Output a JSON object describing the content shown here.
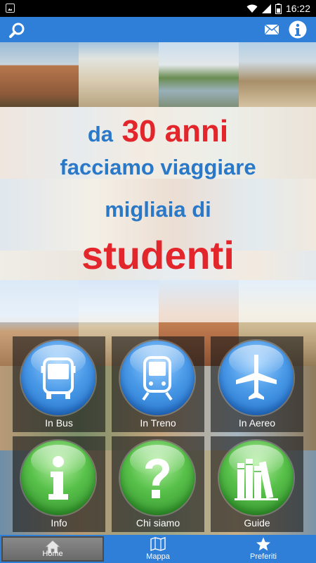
{
  "status_bar": {
    "time": "16:22"
  },
  "app_bar": {
    "search_icon": "search-icon",
    "mail_icon": "mail-icon",
    "info_icon": "info-icon"
  },
  "headline": {
    "line1_prefix": "da",
    "line1_highlight": "30 anni",
    "line2": "facciamo viaggiare",
    "line3": "migliaia di",
    "line4": "studenti"
  },
  "grid": [
    {
      "label": "In Bus",
      "icon": "bus-icon",
      "color": "blue"
    },
    {
      "label": "In Treno",
      "icon": "train-icon",
      "color": "blue"
    },
    {
      "label": "In Aereo",
      "icon": "airplane-icon",
      "color": "blue"
    },
    {
      "label": "Info",
      "icon": "info-letter-icon",
      "color": "green"
    },
    {
      "label": "Chi siamo",
      "icon": "question-mark-icon",
      "color": "green"
    },
    {
      "label": "Guide",
      "icon": "books-icon",
      "color": "green"
    }
  ],
  "tabs": [
    {
      "label": "Home",
      "icon": "home-icon",
      "active": true
    },
    {
      "label": "Mappa",
      "icon": "map-icon",
      "active": false
    },
    {
      "label": "Preferiti",
      "icon": "star-icon",
      "active": false
    }
  ],
  "colors": {
    "app_blue": "#2f7fd8",
    "headline_blue": "#2a78c8",
    "headline_red": "#e3262b",
    "button_blue": "#3a8ae0",
    "button_green": "#45b43a"
  }
}
